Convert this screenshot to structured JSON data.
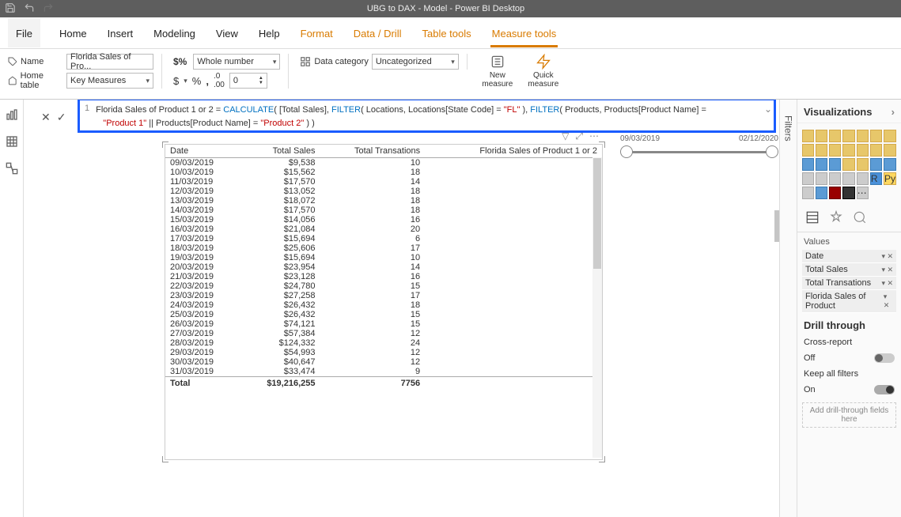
{
  "titlebar": {
    "title": "UBG to DAX - Model - Power BI Desktop"
  },
  "tabs": {
    "file": "File",
    "home": "Home",
    "insert": "Insert",
    "modeling": "Modeling",
    "view": "View",
    "help": "Help",
    "format": "Format",
    "datadrill": "Data / Drill",
    "tabletools": "Table tools",
    "measuretools": "Measure tools"
  },
  "ribbon": {
    "name_label": "Name",
    "name_value": "Florida Sales of Pro...",
    "home_table_label": "Home table",
    "home_table_value": "Key Measures",
    "format_value": "Whole number",
    "decimal_value": "0",
    "data_category_label": "Data category",
    "data_category_value": "Uncategorized",
    "new_measure": "New measure",
    "quick_measure": "Quick measure"
  },
  "formula": {
    "line": "1",
    "plain": "Florida Sales of Product 1 or 2 = ",
    "calc": "CALCULATE",
    "p1": "( [Total Sales], ",
    "filter": "FILTER",
    "p2": "( Locations, Locations[State Code] = ",
    "fl": "\"FL\"",
    "p3": " ), ",
    "p4": "( Products, Products[Product Name] = ",
    "line2a": "\"Product 1\"",
    "or": " || ",
    "line2b": "Products[Product Name] = ",
    "prod2": "\"Product 2\"",
    "end": " ) )"
  },
  "slicer": {
    "start": "09/03/2019",
    "end": "02/12/2020"
  },
  "table": {
    "headers": [
      "Date",
      "Total Sales",
      "Total Transations",
      "Florida Sales of Product 1 or 2"
    ],
    "rows": [
      [
        "09/03/2019",
        "$9,538",
        "10",
        ""
      ],
      [
        "10/03/2019",
        "$15,562",
        "18",
        ""
      ],
      [
        "11/03/2019",
        "$17,570",
        "14",
        ""
      ],
      [
        "12/03/2019",
        "$13,052",
        "18",
        ""
      ],
      [
        "13/03/2019",
        "$18,072",
        "18",
        ""
      ],
      [
        "14/03/2019",
        "$17,570",
        "18",
        ""
      ],
      [
        "15/03/2019",
        "$14,056",
        "16",
        ""
      ],
      [
        "16/03/2019",
        "$21,084",
        "20",
        ""
      ],
      [
        "17/03/2019",
        "$15,694",
        "6",
        ""
      ],
      [
        "18/03/2019",
        "$25,606",
        "17",
        ""
      ],
      [
        "19/03/2019",
        "$15,694",
        "10",
        ""
      ],
      [
        "20/03/2019",
        "$23,954",
        "14",
        ""
      ],
      [
        "21/03/2019",
        "$23,128",
        "16",
        ""
      ],
      [
        "22/03/2019",
        "$24,780",
        "15",
        ""
      ],
      [
        "23/03/2019",
        "$27,258",
        "17",
        ""
      ],
      [
        "24/03/2019",
        "$26,432",
        "18",
        ""
      ],
      [
        "25/03/2019",
        "$26,432",
        "15",
        ""
      ],
      [
        "26/03/2019",
        "$74,121",
        "15",
        ""
      ],
      [
        "27/03/2019",
        "$57,384",
        "12",
        ""
      ],
      [
        "28/03/2019",
        "$124,332",
        "24",
        ""
      ],
      [
        "29/03/2019",
        "$54,993",
        "12",
        ""
      ],
      [
        "30/03/2019",
        "$40,647",
        "12",
        ""
      ],
      [
        "31/03/2019",
        "$33,474",
        "9",
        ""
      ]
    ],
    "total_label": "Total",
    "total_sales": "$19,216,255",
    "total_trans": "7756"
  },
  "viz": {
    "header": "Visualizations",
    "filters": "Filters",
    "values_label": "Values",
    "wells": [
      "Date",
      "Total Sales",
      "Total Transations",
      "Florida Sales of Product"
    ],
    "drill_header": "Drill through",
    "cross_report": "Cross-report",
    "off": "Off",
    "keep_filters": "Keep all filters",
    "on": "On",
    "add_drill": "Add drill-through fields here"
  }
}
